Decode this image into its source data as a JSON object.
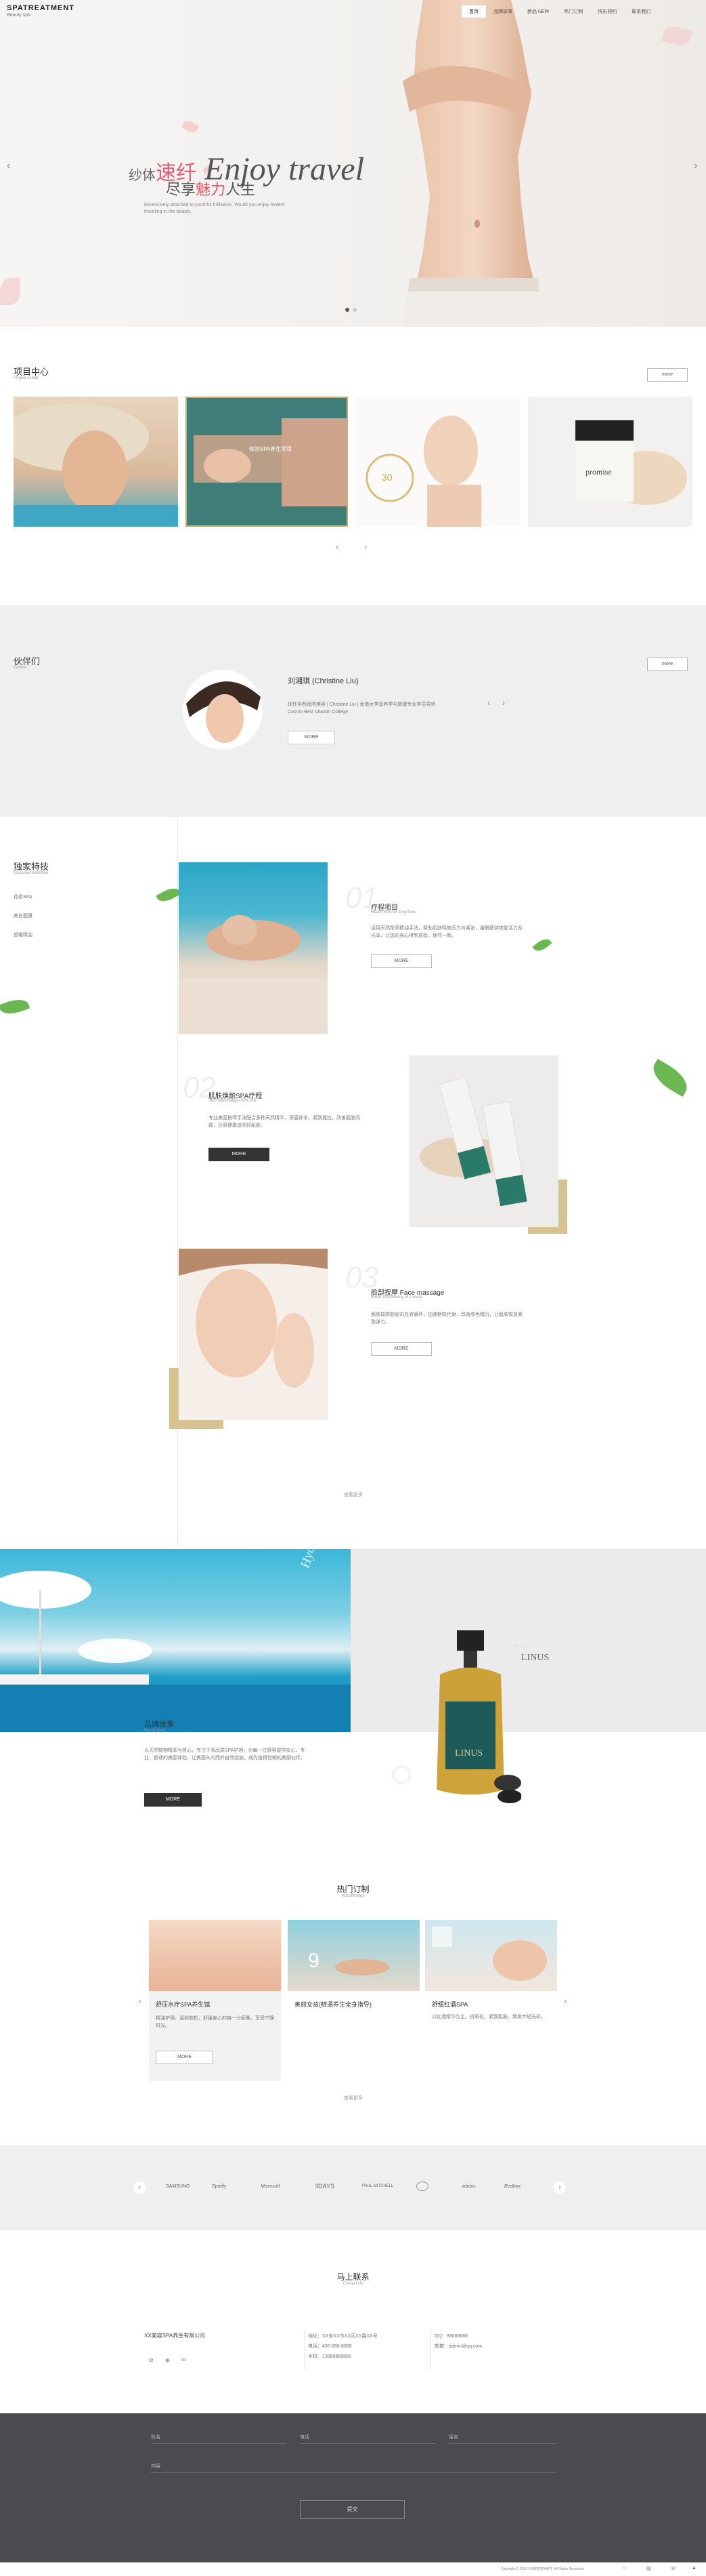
{
  "header": {
    "logo": "SPATREATMENT",
    "logo_sub": "Beauty spa",
    "nav": [
      "首页",
      "品牌故事",
      "新品 NEW",
      "热门订制",
      "快乐预约",
      "联系我们"
    ]
  },
  "hero": {
    "pre": "纱体",
    "red1": "速纤",
    "english": "Enjoy travel",
    "line2_pre": "尽享",
    "red2": "魅力",
    "line2_post": "人生",
    "sub": "Excessively attached to youthful brilliance. Would you enjoy lenient traveling in the beauty."
  },
  "projects": {
    "title": "项目中心",
    "sub": "Project center",
    "more": "more",
    "items": [
      "",
      "体验SPA养生项目",
      "",
      "promise"
    ],
    "card2_title": "体验SPA养生项目"
  },
  "partners": {
    "title": "伙伴们",
    "sub": "Partner",
    "more": "more",
    "name": "刘湘琪 (Christine Liu)",
    "text": "现任华西医院美容 | Christine Liu | 香港大学营养学与健康专业学员导师 Cosmo Best Vitamin College",
    "button": "MORE"
  },
  "features": {
    "title": "独家特技",
    "sub": "Exclusive expertise",
    "side": [
      "花茶SPA",
      "美白面膜",
      "舒缓精油"
    ],
    "items": [
      {
        "num": "01",
        "title": "疗程项目",
        "sub": "Health SPA for long flows",
        "text": "运用天然花草精油手法，帮助肌肤释放压力与紧张，缓解疲劳恢复活力及光泽，让您的身心得到放松，焕然一新。",
        "btn": "MORE"
      },
      {
        "num": "02",
        "title": "肌肤焕颜SPA疗程",
        "sub": "Skin rejuvenation SPA skill",
        "text": "专业美容技师手法配合多种天然精华，深层补水，紧致提拉，改善肌肤问题，还原健康透亮好肌肤。",
        "btn": "MORE"
      },
      {
        "num": "03",
        "title": "脸部按摩 Face massage",
        "sub": "Break SPA beauty of a mask",
        "text": "面部按摩能促进血液循环，加速新陈代谢，改善肤色暗沉，让肌肤恢复紧致弹力。",
        "btn": "MORE"
      }
    ],
    "more_link": "查看更多"
  },
  "brand": {
    "script": "Hydrating Love",
    "title": "品牌故事",
    "sub": "Brand story",
    "text": "以天然植物精萃为核心，专注于高品质SPA护理，为每一位顾客提供安心、专业、舒适的美容体验，让美丽从内而外自然绽放，成为值得信赖的美丽伙伴。",
    "btn": "MORE",
    "product_brand": "LINUS"
  },
  "hot": {
    "title": "热门订制",
    "sub": "Hot offerings",
    "items": [
      {
        "title": "舒压水疗SPA养生馆",
        "text": "精油护理，温和放松，舒缓身心的每一分疲惫，享受宁静时光。",
        "btn": "MORE"
      },
      {
        "title": "美丽女孩(精通养生全身指导)",
        "text": "",
        "btn": ""
      },
      {
        "title": "舒缓红酒SPA",
        "text": "以红酒精华为主，抗氧化、紧致肌肤，焕发年轻光彩。",
        "btn": ""
      }
    ],
    "more_link": "查看更多"
  },
  "logos": [
    "SAMSUNG",
    "Spotify",
    "Microsoft",
    "3DAYS",
    "PAUL MITCHELL",
    "",
    "adidas",
    "Redbox"
  ],
  "contact": {
    "title": "马上联系",
    "sub": "Contact Us",
    "company": "XX美容SPA养生有限公司",
    "addr_label": "地址：XX省XX市XX区XX路XX号",
    "phone": "电话：400-888-8888",
    "mobile": "手机：13888888888",
    "qq": "QQ：88888888",
    "email": "邮箱：admin@qq.com"
  },
  "form": {
    "labels": [
      "姓名",
      "电话",
      "留言",
      "内容"
    ],
    "submit": "提交"
  },
  "footer": {
    "copyright": "Copyright © 2020 XX美容SPA养生 All Rights Reserved",
    "links": [
      "首页",
      "关于",
      "电话",
      "顶部"
    ]
  }
}
